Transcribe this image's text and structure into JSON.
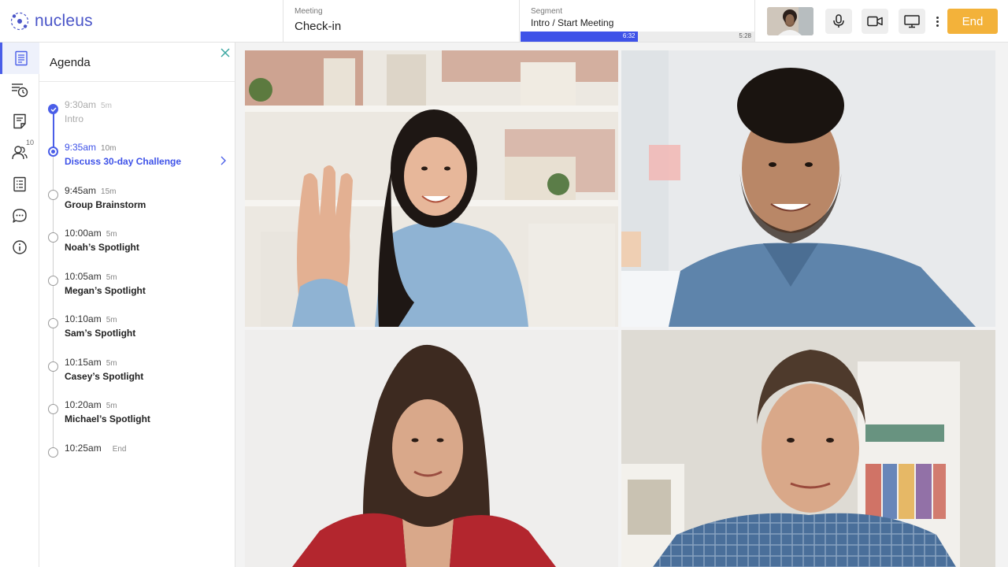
{
  "app": {
    "name": "nucleus"
  },
  "header": {
    "meeting_label": "Meeting",
    "meeting_value": "Check-in",
    "segment_label": "Segment",
    "segment_value": "Intro / Start Meeting",
    "segment_elapsed": "6:32",
    "segment_total": "5:28",
    "segment_progress_fraction": 0.5,
    "end_label": "End"
  },
  "rail": {
    "items": [
      {
        "icon": "agenda-icon",
        "active": true
      },
      {
        "icon": "history-icon",
        "active": false
      },
      {
        "icon": "notes-icon",
        "active": false
      },
      {
        "icon": "participants-icon",
        "active": false,
        "count": "10"
      },
      {
        "icon": "checklist-icon",
        "active": false
      },
      {
        "icon": "chat-icon",
        "active": false
      },
      {
        "icon": "info-icon",
        "active": false
      }
    ]
  },
  "agenda": {
    "title": "Agenda",
    "items": [
      {
        "time": "9:30am",
        "duration": "5m",
        "name": "Intro",
        "state": "past"
      },
      {
        "time": "9:35am",
        "duration": "10m",
        "name": "Discuss 30-day Challenge",
        "state": "current"
      },
      {
        "time": "9:45am",
        "duration": "15m",
        "name": "Group Brainstorm",
        "state": "upcoming"
      },
      {
        "time": "10:00am",
        "duration": "5m",
        "name": "Noah’s Spotlight",
        "state": "upcoming"
      },
      {
        "time": "10:05am",
        "duration": "5m",
        "name": "Megan’s Spotlight",
        "state": "upcoming"
      },
      {
        "time": "10:10am",
        "duration": "5m",
        "name": "Sam’s Spotlight",
        "state": "upcoming"
      },
      {
        "time": "10:15am",
        "duration": "5m",
        "name": "Casey’s Spotlight",
        "state": "upcoming"
      },
      {
        "time": "10:20am",
        "duration": "5m",
        "name": "Michael’s Spotlight",
        "state": "upcoming"
      },
      {
        "time": "10:25am",
        "duration": "End",
        "name": "",
        "state": "upcoming"
      }
    ]
  },
  "colors": {
    "accent": "#3e52e8",
    "end_button": "#f3b23a",
    "brand": "#4a55c8"
  }
}
